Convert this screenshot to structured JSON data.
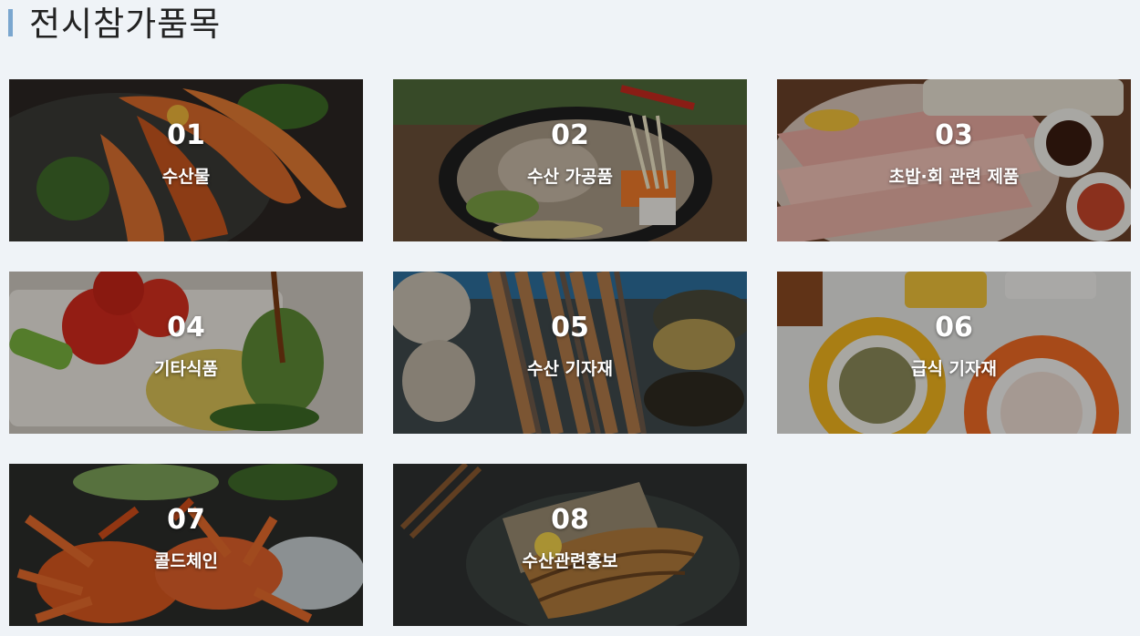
{
  "header": {
    "title": "전시참가품목"
  },
  "colors": {
    "background": "#eff3f7",
    "accent_bar": "#7aa6cf",
    "card_text": "#ffffff"
  },
  "items": [
    {
      "number": "01",
      "label": "수산물",
      "image": "grilled-shrimp-photo"
    },
    {
      "number": "02",
      "label": "수산 가공품",
      "image": "seafood-hotpot-photo"
    },
    {
      "number": "03",
      "label": "초밥·회 관련 제품",
      "image": "sliced-raw-fish-photo"
    },
    {
      "number": "04",
      "label": "기타식품",
      "image": "salad-tomato-photo"
    },
    {
      "number": "05",
      "label": "수산 기자재",
      "image": "shellfish-prawn-photo"
    },
    {
      "number": "06",
      "label": "급식 기자재",
      "image": "meal-bowls-photo"
    },
    {
      "number": "07",
      "label": "콜드체인",
      "image": "snow-crab-photo"
    },
    {
      "number": "08",
      "label": "수산관련홍보",
      "image": "grilled-fish-photo"
    }
  ]
}
